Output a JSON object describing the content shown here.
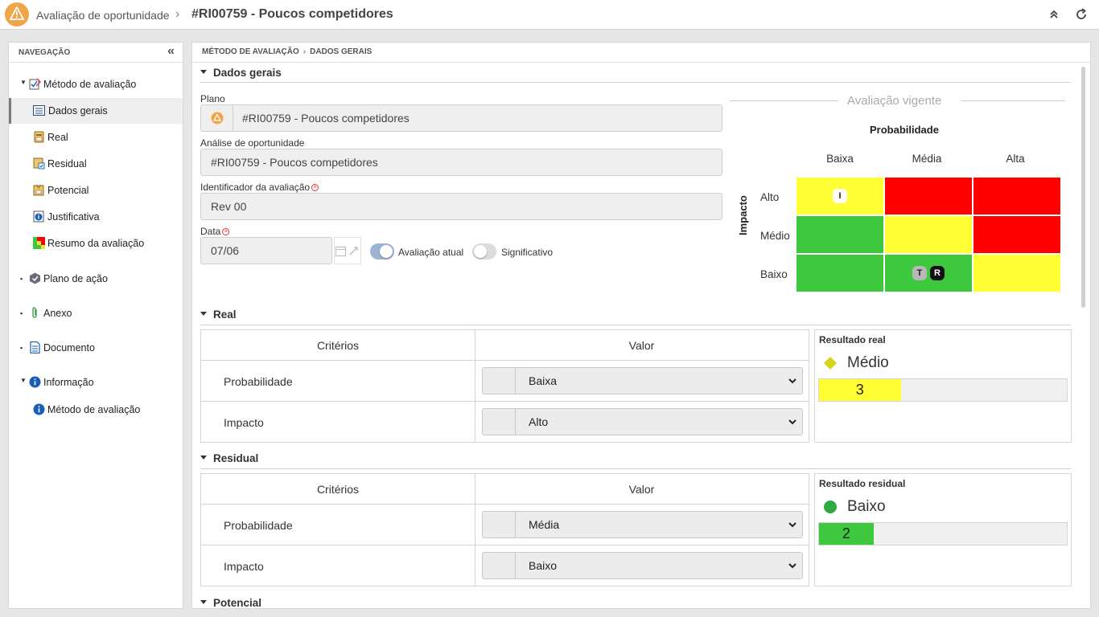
{
  "header": {
    "app_name": "Avaliação de oportunidade",
    "separator": "›",
    "record_title": "#RI00759 - Poucos competidores"
  },
  "sidebar": {
    "title": "NAVEGAÇÃO",
    "collapse_glyph": "«",
    "items": [
      {
        "label": "Método de avaliação",
        "icon": "evaluation-method-icon"
      },
      {
        "label": "Dados gerais",
        "icon": "general-data-icon"
      },
      {
        "label": "Real",
        "icon": "real-icon"
      },
      {
        "label": "Residual",
        "icon": "residual-icon"
      },
      {
        "label": "Potencial",
        "icon": "potential-icon"
      },
      {
        "label": "Justificativa",
        "icon": "justification-icon"
      },
      {
        "label": "Resumo da avaliação",
        "icon": "evaluation-summary-icon"
      },
      {
        "label": "Plano de ação",
        "icon": "action-plan-icon"
      },
      {
        "label": "Anexo",
        "icon": "attachment-icon"
      },
      {
        "label": "Documento",
        "icon": "document-icon"
      },
      {
        "label": "Informação",
        "icon": "info-icon"
      },
      {
        "label": "Método de avaliação",
        "icon": "info-icon"
      }
    ]
  },
  "main": {
    "breadcrumb": [
      "MÉTODO DE AVALIAÇÃO",
      "DADOS GERAIS"
    ],
    "general": {
      "section_title": "Dados gerais",
      "plan_label": "Plano",
      "plan_value": "#RI00759 - Poucos competidores",
      "analysis_label": "Análise de oportunidade",
      "analysis_value": "#RI00759 - Poucos competidores",
      "identifier_label": "Identificador da avaliação",
      "identifier_value": "Rev 00",
      "date_label": "Data",
      "date_value": "07/06",
      "toggle_current_label": "Avaliação atual",
      "toggle_current_on": true,
      "toggle_significant_label": "Significativo",
      "toggle_significant_on": false
    },
    "matrix": {
      "title": "Avaliação vigente",
      "x_title": "Probabilidade",
      "y_title": "Impacto",
      "columns": [
        "Baixa",
        "Média",
        "Alta"
      ],
      "rows": [
        "Alto",
        "Médio",
        "Baixo"
      ],
      "colors": {
        "yellow": "#ffff33",
        "red": "#ff0000",
        "green": "#3dc83d"
      },
      "cells": [
        [
          "yellow",
          "red",
          "red"
        ],
        [
          "green",
          "yellow",
          "red"
        ],
        [
          "green",
          "green",
          "yellow"
        ]
      ],
      "markers": [
        {
          "text": "I",
          "row": 0,
          "col": 0,
          "style": "light"
        },
        {
          "text": "T",
          "row": 2,
          "col": 1,
          "style": "gray"
        },
        {
          "text": "R",
          "row": 2,
          "col": 1,
          "style": "dark"
        }
      ]
    },
    "real": {
      "section_title": "Real",
      "col_criteria": "Critérios",
      "col_value": "Valor",
      "rows": [
        {
          "name": "Probabilidade",
          "value": "Baixa"
        },
        {
          "name": "Impacto",
          "value": "Alto"
        }
      ],
      "result_title": "Resultado real",
      "result_label": "Médio",
      "result_value": "3",
      "result_fraction": 0.33,
      "result_color": "#ffff33",
      "result_marker": "diamond",
      "result_marker_color": "#d4d41a"
    },
    "residual": {
      "section_title": "Residual",
      "col_criteria": "Critérios",
      "col_value": "Valor",
      "rows": [
        {
          "name": "Probabilidade",
          "value": "Média"
        },
        {
          "name": "Impacto",
          "value": "Baixo"
        }
      ],
      "result_title": "Resultado residual",
      "result_label": "Baixo",
      "result_value": "2",
      "result_fraction": 0.22,
      "result_color": "#3dc83d",
      "result_marker": "circle",
      "result_marker_color": "#2eaa3e"
    },
    "potential": {
      "section_title": "Potencial"
    }
  }
}
